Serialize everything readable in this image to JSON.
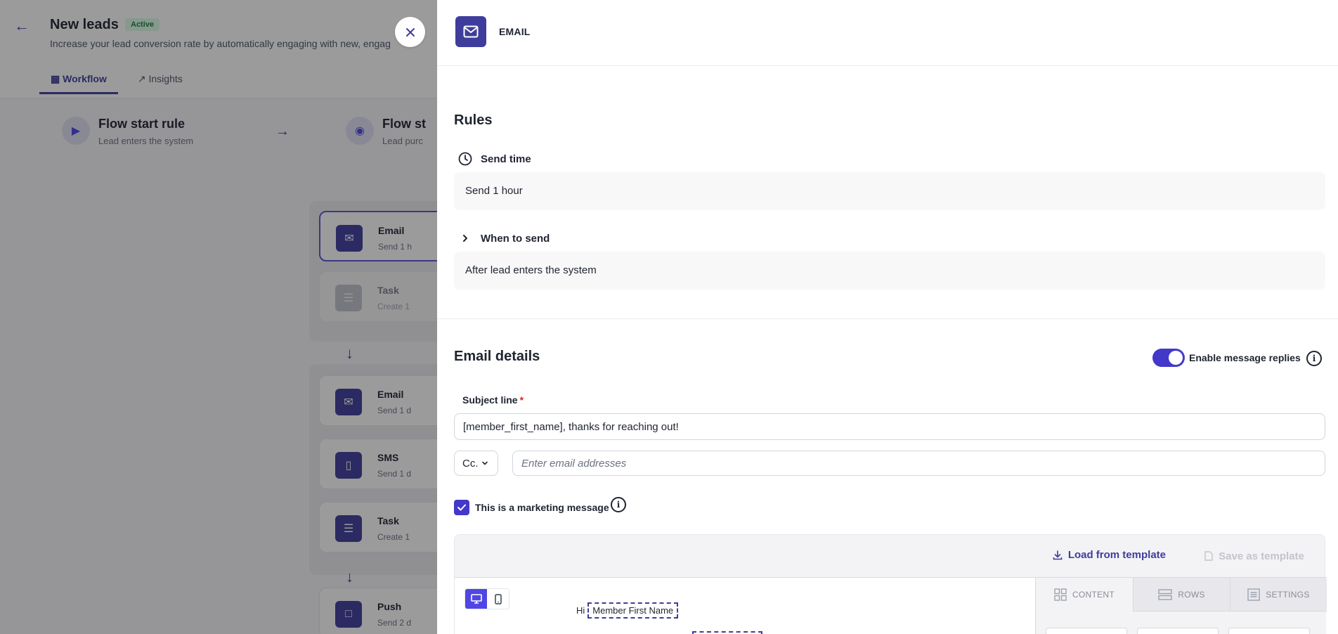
{
  "background": {
    "page_title": "New leads",
    "status_badge": "Active",
    "subtitle": "Increase your lead conversion rate by automatically engaging with new, engag",
    "tabs": [
      {
        "label": "Workflow"
      },
      {
        "label": "Insights"
      }
    ],
    "rules": [
      {
        "title": "Flow start rule",
        "subtitle": "Lead enters the system"
      },
      {
        "title": "Flow st",
        "subtitle": "Lead purc"
      }
    ],
    "steps": [
      {
        "title": "Email",
        "subtitle": "Send 1 h"
      },
      {
        "title": "Task",
        "subtitle": "Create 1"
      },
      {
        "title": "Email",
        "subtitle": "Send 1 d"
      },
      {
        "title": "SMS",
        "subtitle": "Send 1 d"
      },
      {
        "title": "Task",
        "subtitle": "Create 1"
      },
      {
        "title": "Push",
        "subtitle": "Send 2 d"
      }
    ]
  },
  "drawer": {
    "title": "EMAIL",
    "rules_heading": "Rules",
    "send_time": {
      "label": "Send time",
      "value": "Send 1 hour"
    },
    "when_to_send": {
      "label": "When to send",
      "value": "After lead enters the system"
    },
    "email_details_heading": "Email details",
    "enable_replies": {
      "label": "Enable message replies",
      "enabled": true
    },
    "subject": {
      "label": "Subject line",
      "required_mark": "*",
      "value": "[member_first_name], thanks for reaching out!"
    },
    "cc": {
      "selected": "Cc.",
      "placeholder": "Enter email addresses"
    },
    "marketing": {
      "label": "This is a marketing message",
      "checked": true
    },
    "editor": {
      "load_template": "Load from template",
      "save_template": "Save as template",
      "greeting_prefix": "Hi",
      "merge_tag": "Member First Name",
      "side_tabs": [
        {
          "label": "CONTENT",
          "icon": "grid-icon"
        },
        {
          "label": "ROWS",
          "icon": "rows-icon"
        },
        {
          "label": "SETTINGS",
          "icon": "settings-list-icon"
        }
      ]
    }
  },
  "colors": {
    "accent": "#3f3d9c",
    "toggle_on": "#4338ca",
    "required": "#dc2626",
    "badge_green": "#15803d"
  }
}
